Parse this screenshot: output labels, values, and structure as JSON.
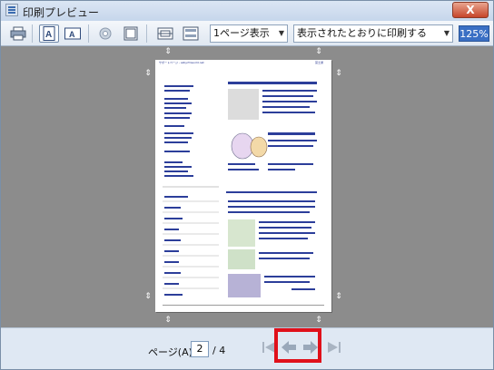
{
  "window": {
    "title": "印刷プレビュー",
    "close_label": "X"
  },
  "toolbar": {
    "buttons": [
      {
        "name": "print-icon"
      },
      {
        "name": "portrait-icon",
        "pressed": true
      },
      {
        "name": "landscape-icon"
      },
      {
        "name": "page-setup-icon"
      },
      {
        "name": "header-footer-icon"
      },
      {
        "name": "fullscreen-icon"
      },
      {
        "name": "fit-width-icon"
      }
    ],
    "pages_per_sheet": "1ページ表示",
    "print_mode": "表示されたとおりに印刷する",
    "zoom": "125%"
  },
  "preview": {
    "header_left": "サポートページ - azby.fmworld.net",
    "header_right": "富士通"
  },
  "status": {
    "page_label": "ページ(A)",
    "current_page": "2",
    "total_pages": "/ 4"
  },
  "nav": {
    "first": "first-page-icon",
    "prev": "previous-page-icon",
    "next": "next-page-icon",
    "last": "last-page-icon"
  },
  "colors": {
    "highlight": "#e0101a",
    "canvas": "#8c8c8c"
  }
}
